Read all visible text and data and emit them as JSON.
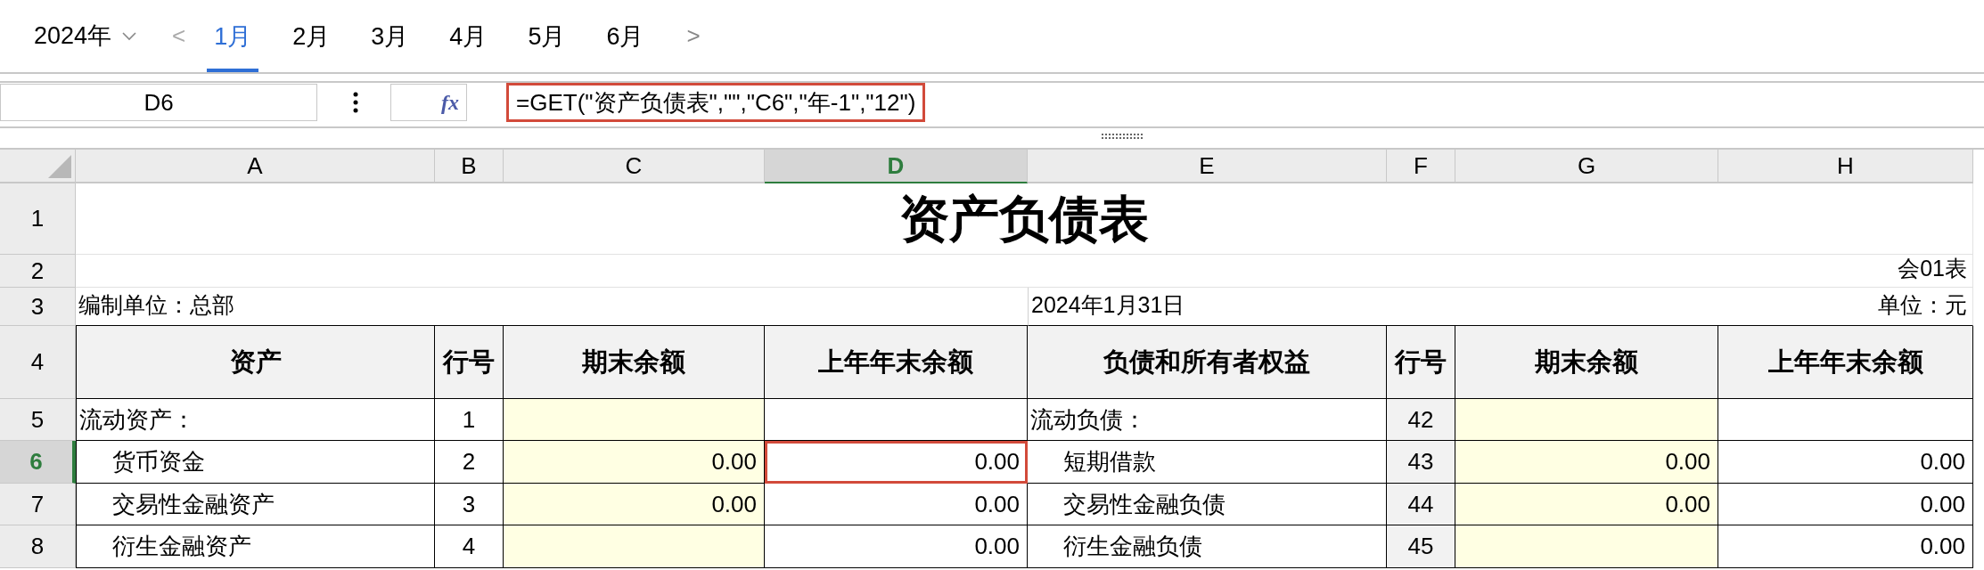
{
  "toolbar": {
    "year": "2024年",
    "prev": "<",
    "next": ">",
    "tabs": [
      {
        "label": "1月",
        "selected": true
      },
      {
        "label": "2月",
        "selected": false
      },
      {
        "label": "3月",
        "selected": false
      },
      {
        "label": "4月",
        "selected": false
      },
      {
        "label": "5月",
        "selected": false
      },
      {
        "label": "6月",
        "selected": false
      }
    ]
  },
  "formula_bar": {
    "cell_ref": "D6",
    "fx": "fx",
    "formula": "=GET(\"资产负债表\",\"\",\"C6\",\"年-1\",\"12\")"
  },
  "sheet": {
    "columns": [
      {
        "label": "A",
        "selected": false
      },
      {
        "label": "B",
        "selected": false
      },
      {
        "label": "C",
        "selected": false
      },
      {
        "label": "D",
        "selected": true
      },
      {
        "label": "E",
        "selected": false
      },
      {
        "label": "F",
        "selected": false
      },
      {
        "label": "G",
        "selected": false
      },
      {
        "label": "H",
        "selected": false
      }
    ],
    "row_numbers": [
      {
        "label": "1",
        "selected": false
      },
      {
        "label": "2",
        "selected": false
      },
      {
        "label": "3",
        "selected": false
      },
      {
        "label": "4",
        "selected": false
      },
      {
        "label": "5",
        "selected": false
      },
      {
        "label": "6",
        "selected": true
      },
      {
        "label": "7",
        "selected": false
      },
      {
        "label": "8",
        "selected": false
      }
    ],
    "title": "资产负债表",
    "form_no": "会01表",
    "unit_label": "编制单位：总部",
    "date": "2024年1月31日",
    "currency": "单位：元",
    "headers": [
      "资产",
      "行号",
      "期末余额",
      "上年年末余额",
      "负债和所有者权益",
      "行号",
      "期末余额",
      "上年年末余额"
    ],
    "rows": [
      {
        "kind": "section",
        "cells": [
          {
            "text": "流动资产：",
            "selected": false
          },
          {
            "text": "1",
            "selected": false
          },
          {
            "selected": false
          },
          {
            "selected": false
          },
          {
            "text": "流动负债：",
            "selected": false
          },
          {
            "text": "42",
            "selected": false
          },
          {
            "selected": false
          },
          {
            "selected": false
          }
        ]
      },
      {
        "kind": "item",
        "cells": [
          {
            "text": "货币资金",
            "selected": false
          },
          {
            "text": "2",
            "selected": false
          },
          {
            "text": "0.00",
            "selected": false
          },
          {
            "text": "0.00",
            "selected": true
          },
          {
            "text": "短期借款",
            "selected": false
          },
          {
            "text": "43",
            "selected": false
          },
          {
            "text": "0.00",
            "selected": false
          },
          {
            "text": "0.00",
            "selected": false
          }
        ]
      },
      {
        "kind": "item",
        "cells": [
          {
            "text": "交易性金融资产",
            "selected": false
          },
          {
            "text": "3",
            "selected": false
          },
          {
            "text": "0.00",
            "selected": false
          },
          {
            "text": "0.00",
            "selected": false
          },
          {
            "text": "交易性金融负债",
            "selected": false
          },
          {
            "text": "44",
            "selected": false
          },
          {
            "text": "0.00",
            "selected": false
          },
          {
            "text": "0.00",
            "selected": false
          }
        ]
      },
      {
        "kind": "item",
        "cells": [
          {
            "text": "衍生金融资产",
            "selected": false
          },
          {
            "text": "4",
            "selected": false
          },
          {
            "selected": false
          },
          {
            "text": "0.00",
            "selected": false
          },
          {
            "text": "衍生金融负债",
            "selected": false
          },
          {
            "text": "45",
            "selected": false
          },
          {
            "selected": false
          },
          {
            "text": "0.00",
            "selected": false
          }
        ]
      }
    ]
  }
}
